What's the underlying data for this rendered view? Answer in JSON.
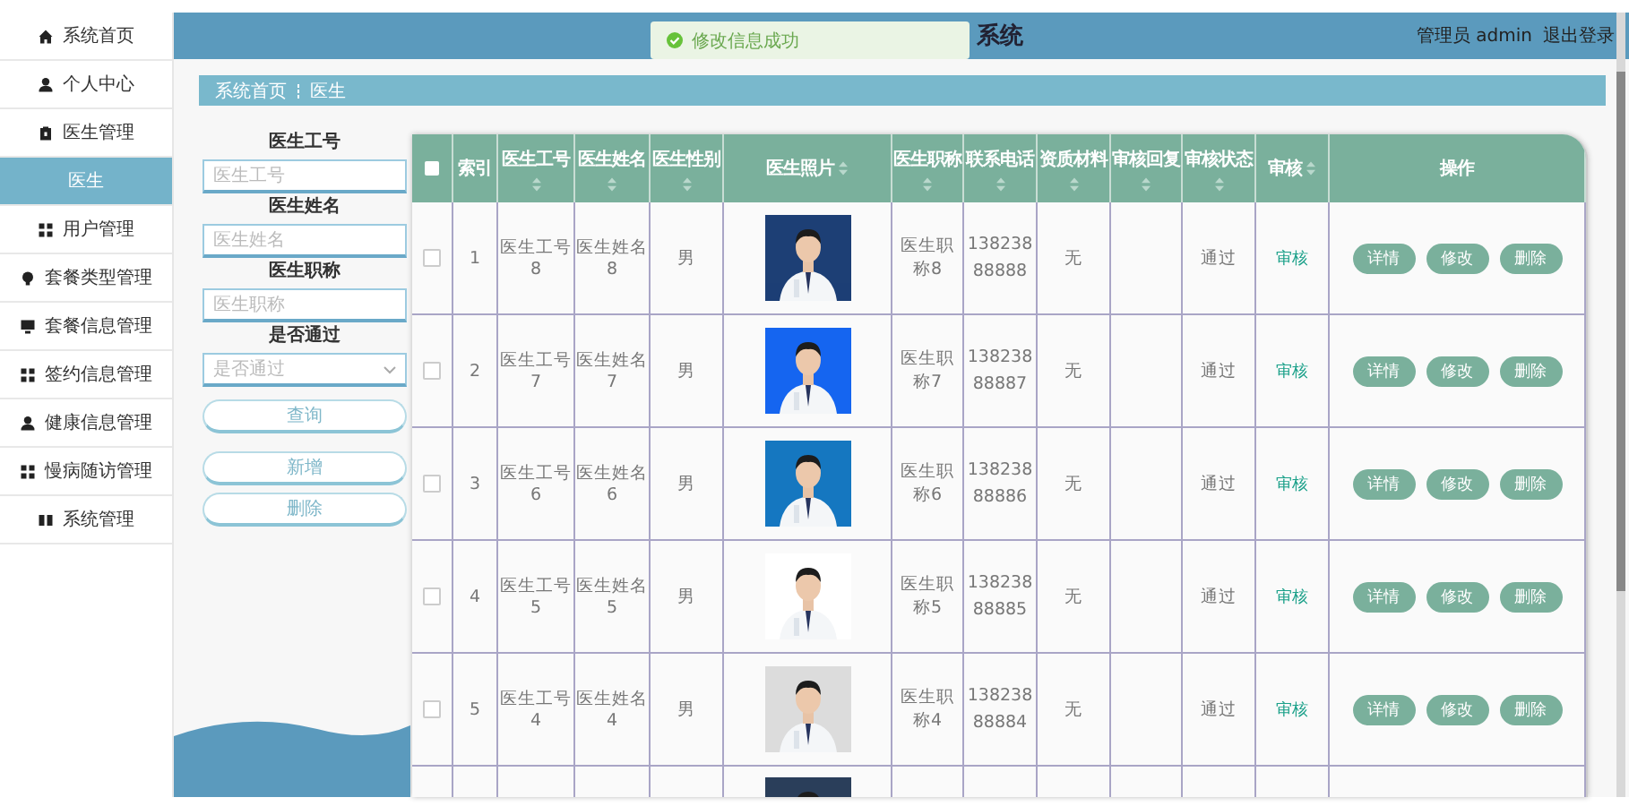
{
  "sidebar": {
    "items": [
      {
        "label": "系统首页",
        "selected": false
      },
      {
        "label": "个人中心",
        "selected": false
      },
      {
        "label": "医生管理",
        "selected": false
      },
      {
        "label": "医生",
        "selected": true
      },
      {
        "label": "用户管理",
        "selected": false
      },
      {
        "label": "套餐类型管理",
        "selected": false
      },
      {
        "label": "套餐信息管理",
        "selected": false
      },
      {
        "label": "签约信息管理",
        "selected": false
      },
      {
        "label": "健康信息管理",
        "selected": false
      },
      {
        "label": "慢病随访管理",
        "selected": false
      },
      {
        "label": "系统管理",
        "selected": false
      }
    ]
  },
  "header": {
    "title": "系统",
    "user": "管理员 admin",
    "logout": "退出登录"
  },
  "toast": {
    "message": "修改信息成功"
  },
  "breadcrumb": [
    "系统首页",
    "医生"
  ],
  "search_form": {
    "fields": [
      {
        "kind": "text",
        "label": "医生工号",
        "placeholder": "医生工号"
      },
      {
        "kind": "text",
        "label": "医生姓名",
        "placeholder": "医生姓名"
      },
      {
        "kind": "text",
        "label": "医生职称",
        "placeholder": "医生职称"
      },
      {
        "kind": "select",
        "label": "是否通过",
        "placeholder": "是否通过"
      }
    ],
    "buttons": [
      "查询",
      "新增",
      "删除"
    ]
  },
  "table": {
    "header_checked": false,
    "columns": [
      {
        "label": "索引",
        "sortable": false
      },
      {
        "label": "医生工号",
        "sortable": true
      },
      {
        "label": "医生姓名",
        "sortable": true
      },
      {
        "label": "医生性别",
        "sortable": true
      },
      {
        "label": "医生照片",
        "sortable": true
      },
      {
        "label": "医生职称",
        "sortable": true
      },
      {
        "label": "联系电话",
        "sortable": true
      },
      {
        "label": "资质材料",
        "sortable": true
      },
      {
        "label": "审核回复",
        "sortable": true
      },
      {
        "label": "审核状态",
        "sortable": true
      },
      {
        "label": "审核",
        "sortable": true
      },
      {
        "label": "操作",
        "sortable": false
      }
    ],
    "rows": [
      {
        "checked": false,
        "index": "1",
        "id": "医生工号8",
        "name": "医生姓名8",
        "gender": "男",
        "title": "医生职称8",
        "phone": "13823888888",
        "qualification": "无",
        "status": "通过",
        "audit": "审核",
        "actions": [
          "详情",
          "修改",
          "删除"
        ]
      },
      {
        "checked": false,
        "index": "2",
        "id": "医生工号7",
        "name": "医生姓名7",
        "gender": "男",
        "title": "医生职称7",
        "phone": "13823888887",
        "qualification": "无",
        "status": "通过",
        "audit": "审核",
        "actions": [
          "详情",
          "修改",
          "删除"
        ]
      },
      {
        "checked": false,
        "index": "3",
        "id": "医生工号6",
        "name": "医生姓名6",
        "gender": "男",
        "title": "医生职称6",
        "phone": "13823888886",
        "qualification": "无",
        "status": "通过",
        "audit": "审核",
        "actions": [
          "详情",
          "修改",
          "删除"
        ]
      },
      {
        "checked": false,
        "index": "4",
        "id": "医生工号5",
        "name": "医生姓名5",
        "gender": "男",
        "title": "医生职称5",
        "phone": "13823888885",
        "qualification": "无",
        "status": "通过",
        "audit": "审核",
        "actions": [
          "详情",
          "修改",
          "删除"
        ]
      },
      {
        "checked": false,
        "index": "5",
        "id": "医生工号4",
        "name": "医生姓名4",
        "gender": "男",
        "title": "医生职称4",
        "phone": "13823888884",
        "qualification": "无",
        "status": "通过",
        "audit": "审核",
        "actions": [
          "详情",
          "修改",
          "删除"
        ]
      }
    ]
  }
}
